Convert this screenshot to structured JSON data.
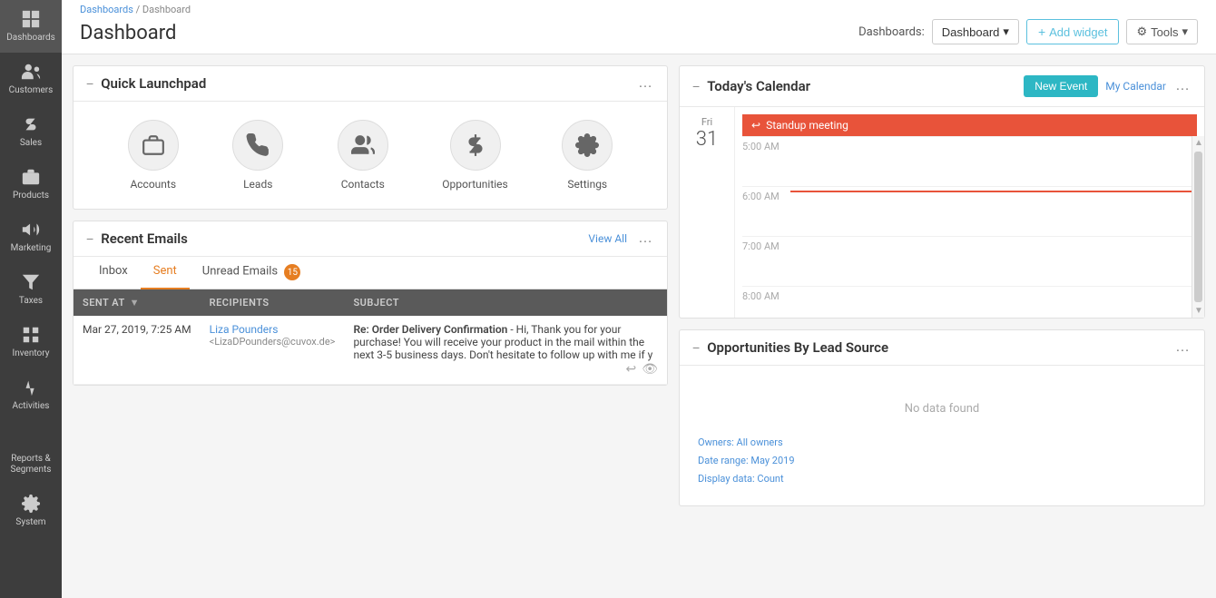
{
  "sidebar": {
    "items": [
      {
        "id": "dashboards",
        "label": "Dashboards",
        "icon": "bar-chart",
        "active": true
      },
      {
        "id": "customers",
        "label": "Customers",
        "icon": "users"
      },
      {
        "id": "sales",
        "label": "Sales",
        "icon": "dollar"
      },
      {
        "id": "products",
        "label": "Products",
        "icon": "briefcase"
      },
      {
        "id": "marketing",
        "label": "Marketing",
        "icon": "megaphone"
      },
      {
        "id": "taxes",
        "label": "Taxes",
        "icon": "filter"
      },
      {
        "id": "inventory",
        "label": "Inventory",
        "icon": "grid"
      },
      {
        "id": "activities",
        "label": "Activities",
        "icon": "puzzle"
      },
      {
        "id": "reports",
        "label": "Reports & Segments",
        "icon": "chart"
      },
      {
        "id": "system",
        "label": "System",
        "icon": "gear"
      }
    ]
  },
  "header": {
    "breadcrumb_link": "Dashboards",
    "breadcrumb_sep": "/",
    "breadcrumb_current": "Dashboard",
    "title": "Dashboard",
    "dashboards_label": "Dashboards:",
    "dropdown_label": "Dashboard",
    "add_widget_label": "+ Add widget",
    "tools_label": "Tools"
  },
  "quick_launchpad": {
    "title": "Quick Launchpad",
    "items": [
      {
        "id": "accounts",
        "label": "Accounts",
        "icon": "briefcase"
      },
      {
        "id": "leads",
        "label": "Leads",
        "icon": "phone"
      },
      {
        "id": "contacts",
        "label": "Contacts",
        "icon": "contacts"
      },
      {
        "id": "opportunities",
        "label": "Opportunities",
        "icon": "dollar"
      },
      {
        "id": "settings",
        "label": "Settings",
        "icon": "gear"
      }
    ]
  },
  "recent_emails": {
    "title": "Recent Emails",
    "view_all": "View All",
    "tabs": [
      {
        "id": "inbox",
        "label": "Inbox",
        "active": false
      },
      {
        "id": "sent",
        "label": "Sent",
        "active": true
      },
      {
        "id": "unread",
        "label": "Unread Emails",
        "badge": "15",
        "active": false
      }
    ],
    "table": {
      "columns": [
        "SENT AT",
        "RECIPIENTS",
        "SUBJECT"
      ],
      "rows": [
        {
          "sent_at": "Mar 27, 2019, 7:25 AM",
          "recipient_name": "Liza Pounders",
          "recipient_email": "<LizaDPounders@cuvox.de>",
          "subject_bold": "Re: Order Delivery Confirmation",
          "subject_body": " - Hi, Thank you for your purchase! You will receive your product in the mail within the next 3-5 business days. Don't hesitate to follow up with me if y"
        }
      ]
    }
  },
  "calendar": {
    "title": "Today's Calendar",
    "new_event_label": "New Event",
    "my_calendar_label": "My Calendar",
    "day_name": "Fri",
    "day_num": "31",
    "event": {
      "label": "Standup meeting",
      "icon": "reply"
    },
    "time_slots": [
      {
        "label": "5:00 AM"
      },
      {
        "label": "6:00 AM",
        "has_line": true
      },
      {
        "label": "7:00 AM"
      },
      {
        "label": "8:00 AM"
      }
    ]
  },
  "opportunities": {
    "title": "Opportunities By Lead Source",
    "no_data": "No data found",
    "meta": [
      "Owners: All owners",
      "Date range: May 2019",
      "Display data: Count"
    ]
  }
}
